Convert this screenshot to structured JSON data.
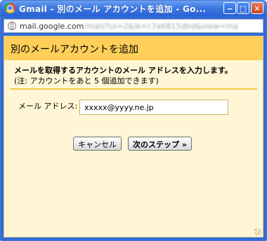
{
  "window": {
    "title": "Gmail - 別のメール アカウントを追加 - Go...",
    "minimize_glyph": "‒",
    "maximize_glyph": "□",
    "close_glyph": "✕"
  },
  "addressbar": {
    "domain": "mail.google.com",
    "path": "/mail/?ui=2&ik=c7a6815dbd&view=ma"
  },
  "dialog": {
    "title": "別のメールアカウントを追加",
    "instruction": "メールを取得するアカウントのメール アドレスを入力します。",
    "note": "(注: アカウントをあと 5 個追加できます)",
    "email_label": "メール アドレス:",
    "email_value": "xxxxx@yyyy.ne.jp",
    "cancel_label": "キャンセル",
    "next_label": "次のステップ »"
  },
  "colors": {
    "header": "#ffcf59",
    "page_bg": "#fff6d5",
    "titlebar": "#3d79e3"
  }
}
